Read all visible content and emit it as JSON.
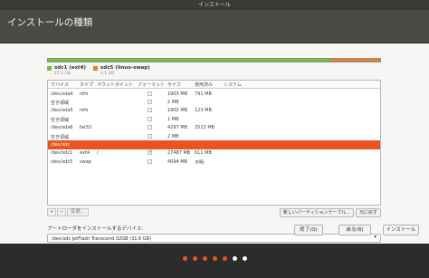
{
  "window": {
    "title": "インストール"
  },
  "header": {
    "title": "インストールの種類"
  },
  "usage": {
    "used_color": "#73c234",
    "swap_color": "#e47f2b",
    "legend": [
      {
        "name": "sdc1 (ext4)",
        "size": "27.5 GB",
        "color": "#73c234"
      },
      {
        "name": "sdc5 (linux-swap)",
        "size": "4.1 GB",
        "color": "#e47f2b"
      }
    ]
  },
  "table": {
    "columns": [
      "デバイス",
      "タイプ",
      "マウントポイント",
      "フォーマット",
      "サイズ",
      "使用済み",
      "システム"
    ],
    "rows": [
      {
        "device": "/dev/sda4",
        "type": "ntfs",
        "mount": "",
        "format": false,
        "show_check": true,
        "size": "1903 MB",
        "used": "791 MB",
        "system": ""
      },
      {
        "device": "空き領域",
        "type": "",
        "mount": "",
        "format": false,
        "show_check": true,
        "size": "2 MB",
        "used": "",
        "system": ""
      },
      {
        "device": "/dev/sda5",
        "type": "ntfs",
        "mount": "",
        "format": false,
        "show_check": true,
        "size": "1902 MB",
        "used": "123 MB",
        "system": ""
      },
      {
        "device": "空き領域",
        "type": "",
        "mount": "",
        "format": false,
        "show_check": true,
        "size": "1 MB",
        "used": "",
        "system": ""
      },
      {
        "device": "/dev/sda6",
        "type": "fat32",
        "mount": "",
        "format": false,
        "show_check": true,
        "size": "4297 MB",
        "used": "2513 MB",
        "system": ""
      },
      {
        "device": "空き領域",
        "type": "",
        "mount": "",
        "format": false,
        "show_check": true,
        "size": "2 MB",
        "used": "",
        "system": ""
      },
      {
        "device": "/dev/sdc",
        "type": "",
        "mount": "",
        "format": false,
        "show_check": false,
        "size": "",
        "used": "",
        "system": "",
        "selected": true
      },
      {
        "device": "/dev/sdc1",
        "type": "ext4",
        "mount": "/",
        "format": true,
        "show_check": true,
        "size": "27487 MB",
        "used": "611 MB",
        "system": ""
      },
      {
        "device": "/dev/sdc5",
        "type": "swap",
        "mount": "",
        "format": false,
        "show_check": true,
        "size": "4094 MB",
        "used": "不明",
        "system": ""
      }
    ]
  },
  "toolbar": {
    "add": "+",
    "remove": "−",
    "change": "変更...",
    "new_table": "新しいパーティションテーブル...",
    "revert": "元に戻す"
  },
  "bootloader": {
    "label": "ブートローダをインストールするデバイス:",
    "value": "/dev/sdc   JetFlash Transcend 32GB (31.6 GB)"
  },
  "buttons": {
    "quit": "終了(Q)",
    "back": "戻る(B)",
    "install": "インストール"
  },
  "progress": {
    "total_steps": 7,
    "current_step": 5,
    "active_color": "#e95420",
    "inactive_color": "#ffffff"
  }
}
